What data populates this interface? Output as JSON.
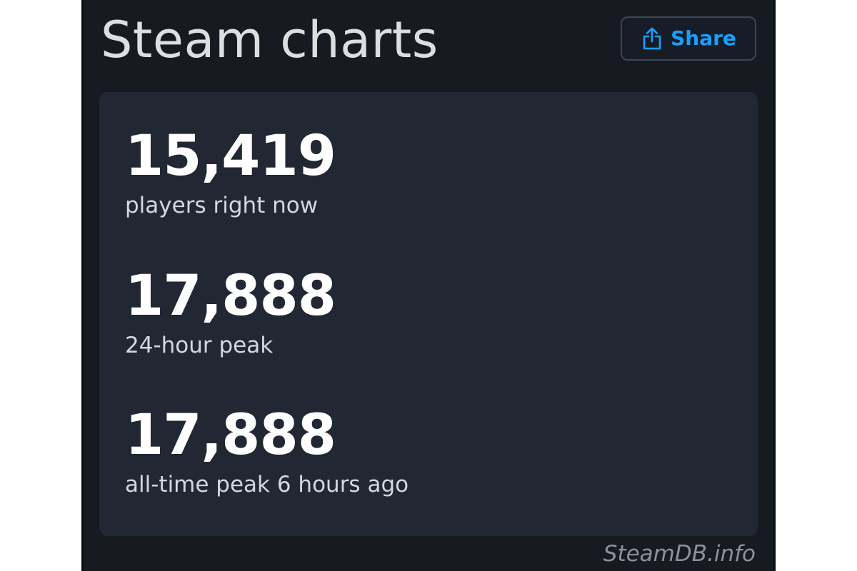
{
  "header": {
    "title": "Steam charts",
    "share_label": "Share",
    "share_icon": "share-icon"
  },
  "stats": [
    {
      "value": "15,419",
      "label": "players right now"
    },
    {
      "value": "17,888",
      "label": "24-hour peak"
    },
    {
      "value": "17,888",
      "label": "all-time peak 6 hours ago"
    }
  ],
  "watermark": "SteamDB.info",
  "colors": {
    "page_background": "#171a21",
    "card_background": "#212834",
    "accent": "#1a9fff",
    "value_text": "#ffffff",
    "label_text": "#d4d7dc"
  }
}
